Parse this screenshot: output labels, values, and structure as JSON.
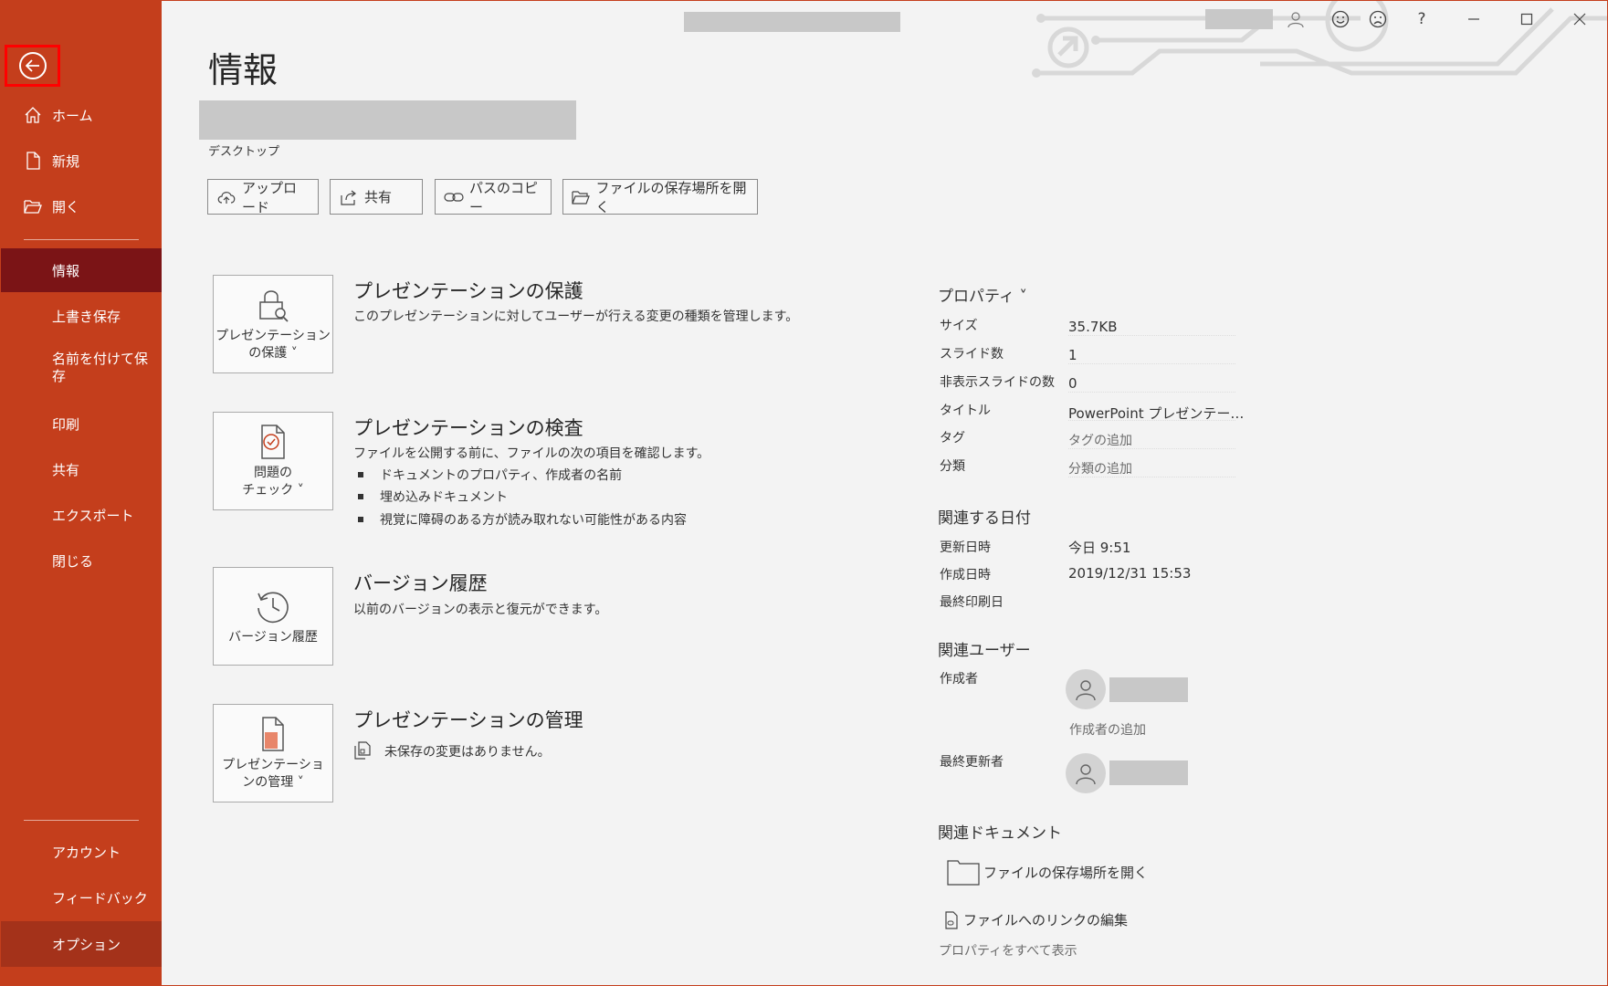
{
  "sidebar": {
    "back_label": "戻る",
    "home": "ホーム",
    "new": "新規",
    "open": "開く",
    "info": "情報",
    "save": "上書き保存",
    "save_as": "名前を付けて保存",
    "print": "印刷",
    "share": "共有",
    "export": "エクスポート",
    "close": "閉じる",
    "account": "アカウント",
    "feedback": "フィードバック",
    "options": "オプション"
  },
  "topbar": {
    "help": "?",
    "icons": [
      "user-icon",
      "smile-icon",
      "frown-icon",
      "help-icon",
      "minimize-icon",
      "maximize-icon",
      "close-icon"
    ]
  },
  "main": {
    "title": "情報",
    "location": "デスクトップ",
    "actions": {
      "upload": "アップロード",
      "share": "共有",
      "copy_path": "パスのコピー",
      "open_location": "ファイルの保存場所を開く"
    },
    "protect": {
      "card_line1": "プレゼンテーション",
      "card_line2": "の保護 ˅",
      "title": "プレゼンテーションの保護",
      "desc": "このプレゼンテーションに対してユーザーが行える変更の種類を管理します。"
    },
    "inspect": {
      "card_line1": "問題の",
      "card_line2": "チェック ˅",
      "title": "プレゼンテーションの検査",
      "desc": "ファイルを公開する前に、ファイルの次の項目を確認します。",
      "bullets": [
        "ドキュメントのプロパティ、作成者の名前",
        "埋め込みドキュメント",
        "視覚に障碍のある方が読み取れない可能性がある内容"
      ]
    },
    "version": {
      "card_line1": "バージョン履歴",
      "title": "バージョン履歴",
      "desc": "以前のバージョンの表示と復元ができます。"
    },
    "manage": {
      "card_line1": "プレゼンテーショ",
      "card_line2": "ンの管理 ˅",
      "title": "プレゼンテーションの管理",
      "desc": "未保存の変更はありません。"
    }
  },
  "properties": {
    "heading": "プロパティ ˅",
    "rows": [
      {
        "label": "サイズ",
        "value": "35.7KB"
      },
      {
        "label": "スライド数",
        "value": "1"
      },
      {
        "label": "非表示スライドの数",
        "value": "0"
      },
      {
        "label": "タイトル",
        "value": "PowerPoint プレゼンテー…"
      },
      {
        "label": "タグ",
        "value": "タグの追加"
      },
      {
        "label": "分類",
        "value": "分類の追加"
      }
    ],
    "dates_heading": "関連する日付",
    "dates": [
      {
        "label": "更新日時",
        "value": "今日 9:51"
      },
      {
        "label": "作成日時",
        "value": "2019/12/31 15:53"
      },
      {
        "label": "最終印刷日",
        "value": ""
      }
    ],
    "people_heading": "関連ユーザー",
    "author_label": "作成者",
    "add_author": "作成者の追加",
    "last_modified_label": "最終更新者",
    "docs_heading": "関連ドキュメント",
    "open_location": "ファイルの保存場所を開く",
    "edit_links": "ファイルへのリンクの編集",
    "show_all": "プロパティをすべて表示"
  },
  "colors": {
    "sidebar_bg": "#c43e1c",
    "sidebar_active": "#7b1416",
    "highlight": "#ff0000"
  }
}
